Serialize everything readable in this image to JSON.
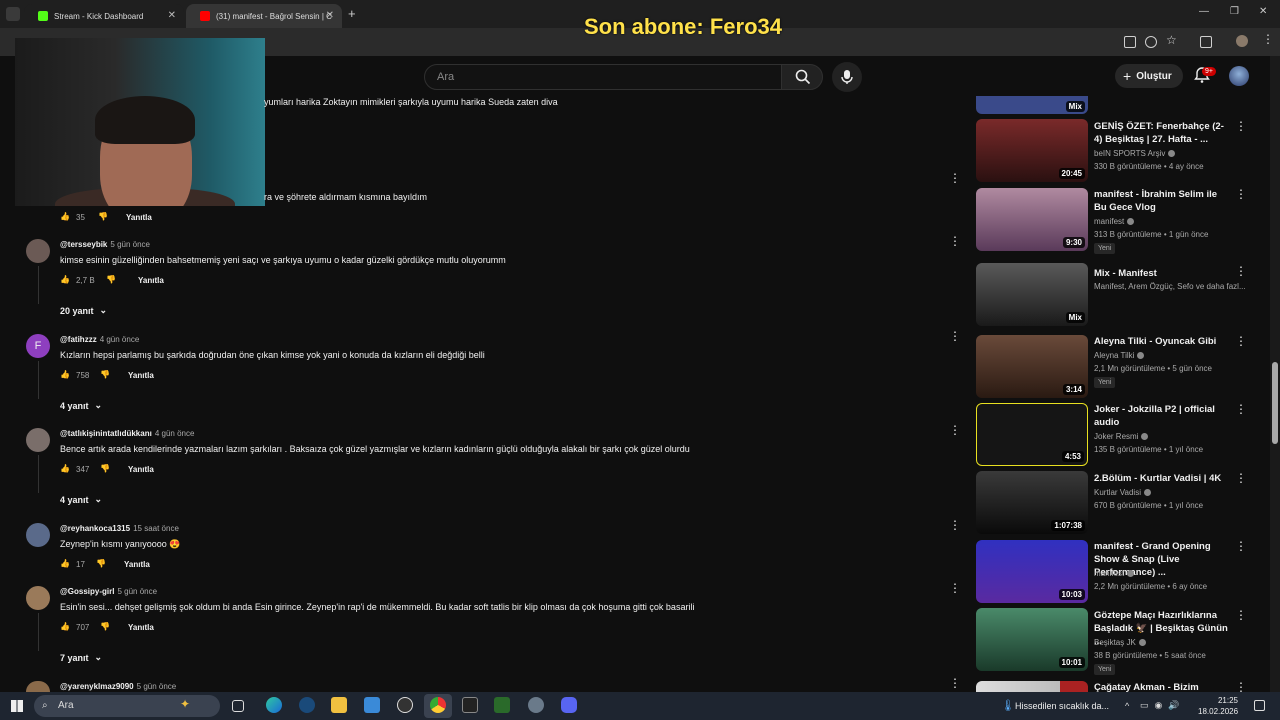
{
  "browser": {
    "tabs": [
      {
        "label": "Stream - Kick Dashboard",
        "favicon_color": "#53fc18"
      },
      {
        "label": "(31) manifest - Bağrol Sensin | C",
        "favicon_color": "#ff0000"
      }
    ],
    "new_tab_symbol": "+",
    "overlay_text": "Son abone: Fero34"
  },
  "header": {
    "search_placeholder": "Ara",
    "create_label": "Oluştur",
    "notification_badge": "9+"
  },
  "comments": [
    {
      "text": "yumları harika Zoktayın mimikleri şarkıyla uyumu harika Sueda zaten diva"
    },
    {
      "text": "ra ve şöhrete aldırmam kısmına bayıldım",
      "likes": "35",
      "reply_label": "Yanıtla"
    },
    {
      "author": "@tersseybik",
      "time": "5 gün önce",
      "text": "kimse esinin güzelliğinden bahsetmemiş yeni saçı ve şarkıya uyumu o kadar güzelki gördükçe mutlu oluyorumm",
      "likes": "2,7 B",
      "reply_label": "Yanıtla",
      "replies": "20 yanıt",
      "avatar_color": "#6b5a55"
    },
    {
      "author": "@fatihzzz",
      "time": "4 gün önce",
      "text": "Kızların hepsi parlamış bu şarkıda doğrudan öne çıkan kimse yok yani o konuda da kızların eli değdiği belli",
      "likes": "758",
      "reply_label": "Yanıtla",
      "replies": "4 yanıt",
      "avatar_color": "#8e3fbf",
      "avatar_letter": "F"
    },
    {
      "author": "@tatlıkişinintatlıdükkanı",
      "time": "4 gün önce",
      "text": "Bence artık arada kendilerinde yazmaları lazım şarkıları . Baksaıza çok güzel yazmışlar ve kızların kadınların güçlü olduğuyla alakalı bir şarkı çok güzel olurdu",
      "likes": "347",
      "reply_label": "Yanıtla",
      "replies": "4 yanıt",
      "avatar_color": "#7a6e6a"
    },
    {
      "author": "@reyhankoca1315",
      "time": "15 saat önce",
      "text": "Zeynep'in kısmı yanıyoooo 😍",
      "likes": "17",
      "reply_label": "Yanıtla",
      "avatar_color": "#5a6a8a"
    },
    {
      "author": "@Gossipy-girl",
      "time": "5 gün önce",
      "text": "Esin'in sesi... dehşet gelişmiş şok oldum bi anda Esin girince. Zeynep'in rap'i de mükemmeldi. Bu kadar soft tatlis bir klip olması da çok hoşuma gitti çok basarili",
      "likes": "707",
      "reply_label": "Yanıtla",
      "replies": "7 yanıt",
      "avatar_color": "#9a7a5a"
    },
    {
      "author": "@yarenyklmaz9090",
      "time": "5 gün önce",
      "avatar_color": "#8a6a4a"
    }
  ],
  "sidebar": {
    "videos": [
      {
        "title": "",
        "duration": "Mix",
        "thumb_color": "#3a4a8a"
      },
      {
        "title": "GENİŞ ÖZET: Fenerbahçe (2-4) Beşiktaş | 27. Hafta - ...",
        "channel": "beIN SPORTS Arşiv",
        "meta": "330 B görüntüleme • 4 ay önce",
        "duration": "20:45",
        "thumb_color": "#5a1a1a"
      },
      {
        "title": "manifest - İbrahim Selim ile Bu Gece Vlog",
        "channel": "manifest",
        "meta": "313 B görüntüleme • 1 gün önce",
        "badge": "Yeni",
        "duration": "9:30",
        "thumb_color": "#8a6a7a"
      },
      {
        "title": "Mix - Manifest",
        "channel": "Manifest, Arem Özgüç, Sefo ve daha fazl...",
        "meta": "",
        "duration": "Mix",
        "thumb_color": "#3a3a3a"
      },
      {
        "title": "Aleyna Tilki - Oyuncak Gibi",
        "channel": "Aleyna Tilki",
        "meta": "2,1 Mn görüntüleme • 5 gün önce",
        "badge": "Yeni",
        "duration": "3:14",
        "thumb_color": "#5a3a2a"
      },
      {
        "title": "Joker - Jokzilla P2 | official audio",
        "channel": "Joker Resmi",
        "meta": "135 B görüntüleme • 1 yıl önce",
        "duration": "4:53",
        "thumb_color": "#1a1a1a"
      },
      {
        "title": "2.Bölüm - Kurtlar Vadisi | 4K",
        "channel": "Kurtlar Vadisi",
        "meta": "670 B görüntüleme • 1 yıl önce",
        "duration": "1:07:38",
        "thumb_color": "#2a2a2a"
      },
      {
        "title": "manifest - Grand Opening Show & Snap (Live Performance) ...",
        "channel": "manifest",
        "meta": "2,2 Mn görüntüleme • 6 ay önce",
        "duration": "10:03",
        "thumb_color": "#2a2aa0"
      },
      {
        "title": "Göztepe Maçı Hazırlıklarına Başladık 🦅 | Beşiktaş Günün ...",
        "channel": "Beşiktaş JK",
        "meta": "38 B görüntüleme • 5 saat önce",
        "badge": "Yeni",
        "duration": "10:01",
        "thumb_color": "#2a5a3a"
      },
      {
        "title": "Çağatay Akman - Bizim Hikaye",
        "duration": "",
        "thumb_color": "#aa2222"
      }
    ]
  },
  "taskbar": {
    "search_label": "Ara",
    "weather": "Hissedilen sıcaklık da...",
    "time": "21:25",
    "date": "18.02.2026"
  }
}
